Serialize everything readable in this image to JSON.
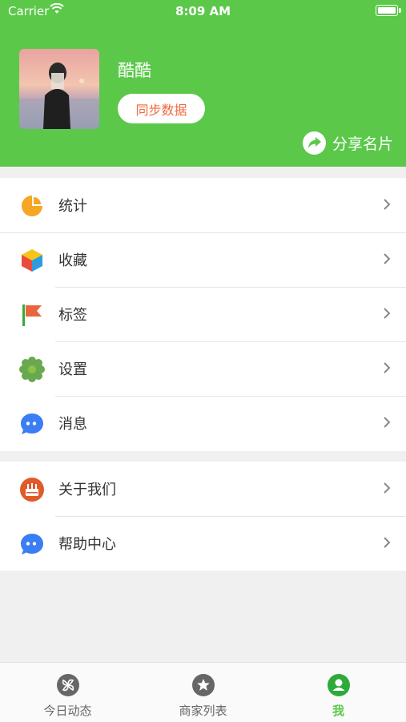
{
  "status_bar": {
    "carrier": "Carrier",
    "time": "8:09 AM"
  },
  "profile": {
    "username": "酷酷",
    "sync_label": "同步数据",
    "share_label": "分享名片"
  },
  "menu_group_1": [
    {
      "label": "统计",
      "icon": "pie-chart-icon"
    },
    {
      "label": "收藏",
      "icon": "cube-icon"
    },
    {
      "label": "标签",
      "icon": "flag-icon"
    },
    {
      "label": "设置",
      "icon": "gear-icon"
    },
    {
      "label": "消息",
      "icon": "chat-bubble-icon"
    }
  ],
  "menu_group_2": [
    {
      "label": "关于我们",
      "icon": "cake-icon"
    },
    {
      "label": "帮助中心",
      "icon": "chat-bubble-icon"
    }
  ],
  "tabbar": [
    {
      "label": "今日动态",
      "icon": "pinwheel-icon",
      "active": false
    },
    {
      "label": "商家列表",
      "icon": "star-icon",
      "active": false
    },
    {
      "label": "我",
      "icon": "person-icon",
      "active": true
    }
  ],
  "colors": {
    "brand_green": "#5bc84a",
    "sync_text": "#ee6a3e",
    "chat_blue": "#3b7df5"
  }
}
